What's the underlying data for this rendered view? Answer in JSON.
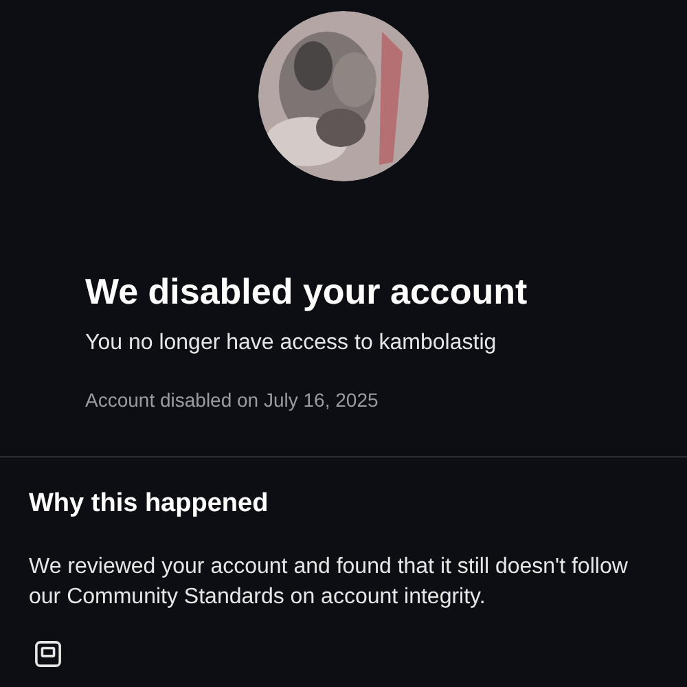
{
  "header": {
    "title": "We disabled your account",
    "subtitle": "You no longer have access to kambolastig",
    "date": "Account disabled on July 16, 2025"
  },
  "reason": {
    "heading": "Why this happened",
    "body": "We reviewed your account and found that it still doesn't follow our Community Standards on account integrity."
  }
}
